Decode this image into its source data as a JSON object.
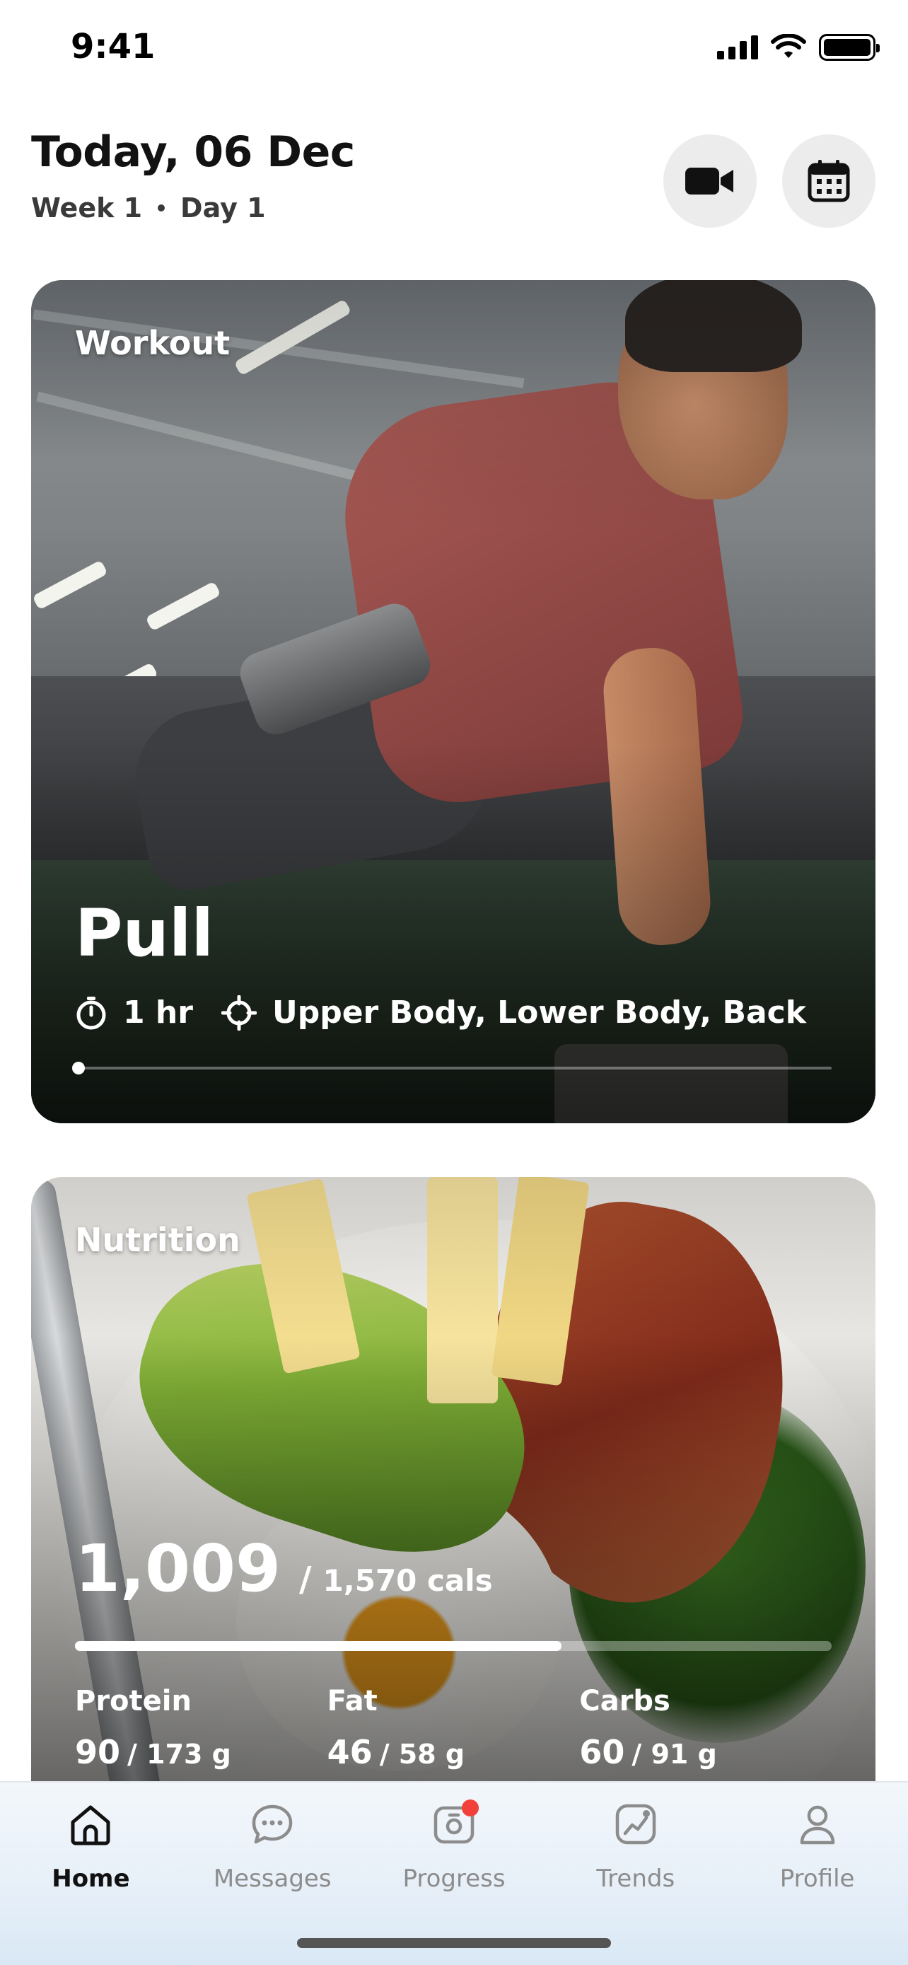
{
  "status_bar": {
    "time": "9:41"
  },
  "header": {
    "title": "Today, 06 Dec",
    "week": "Week 1",
    "day": "Day 1"
  },
  "actions": {
    "video_icon": "video-camera-icon",
    "calendar_icon": "calendar-icon"
  },
  "workout": {
    "label": "Workout",
    "name": "Pull",
    "duration": "1 hr",
    "targets": "Upper Body, Lower Body, Back",
    "carousel_position": 0
  },
  "nutrition": {
    "label": "Nutrition",
    "calories_consumed": "1,009",
    "calories_separator": "/",
    "calories_goal": "1,570 cals",
    "calorie_progress": 0.643,
    "macros": [
      {
        "label": "Protein",
        "current": "90",
        "rest": "/ 173 g"
      },
      {
        "label": "Fat",
        "current": "46",
        "rest": "/ 58 g"
      },
      {
        "label": "Carbs",
        "current": "60",
        "rest": "/ 91 g"
      }
    ]
  },
  "tabs": [
    {
      "label": "Home",
      "icon": "home-icon",
      "active": true
    },
    {
      "label": "Messages",
      "icon": "chat-bubble-icon",
      "active": false
    },
    {
      "label": "Progress",
      "icon": "camera-icon",
      "active": false,
      "badge": true
    },
    {
      "label": "Trends",
      "icon": "trend-chart-icon",
      "active": false
    },
    {
      "label": "Profile",
      "icon": "person-icon",
      "active": false
    }
  ],
  "colors": {
    "accent_text": "#111111",
    "inactive_tab": "#8c8c8c",
    "badge": "#f2413a",
    "button_bg": "#ececec"
  }
}
